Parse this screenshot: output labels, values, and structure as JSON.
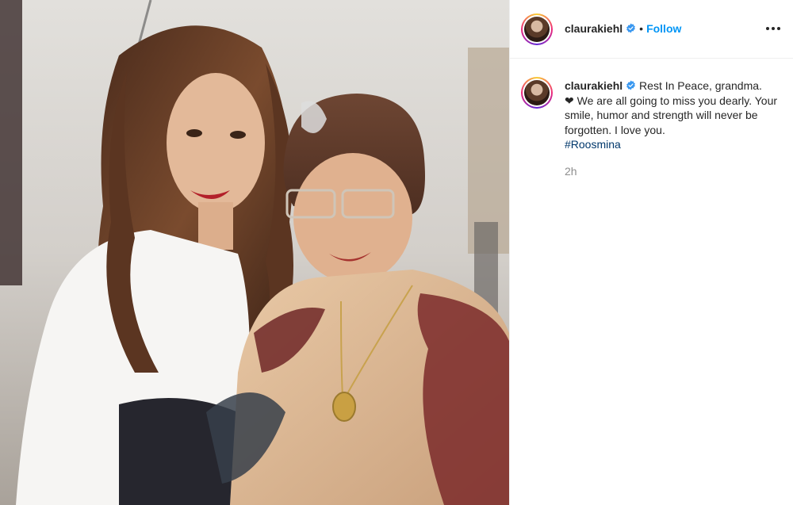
{
  "post": {
    "photo_alt": "",
    "header": {
      "username": "claurakiehl",
      "separator": "•",
      "follow_label": "Follow",
      "more_icon": "more-options-icon"
    },
    "caption": {
      "username": "claurakiehl",
      "line1": "Rest In Peace, grandma.",
      "heart": "❤",
      "line2": "We are all going to miss you dearly. Your smile, humor and strength will never be forgotten. I love you.",
      "hashtag": "#Roosmina"
    },
    "timestamp": "2h"
  },
  "colors": {
    "accent": "#0095f6",
    "hashtag": "#00376b",
    "muted": "#8e8e8e",
    "verified": "#3897f0"
  }
}
